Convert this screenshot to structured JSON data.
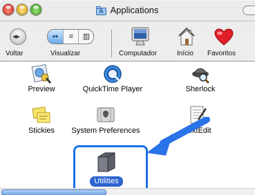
{
  "window": {
    "title": "Applications",
    "accent_color": "#1f6fe6"
  },
  "toolbar": {
    "back_label": "Voltar",
    "view_label": "Visualizar",
    "computer_label": "Computador",
    "home_label": "Início",
    "favorites_label": "Favoritos"
  },
  "items": [
    {
      "label": "Preview",
      "icon": "preview-icon"
    },
    {
      "label": "QuickTime Player",
      "icon": "quicktime-icon"
    },
    {
      "label": "Sherlock",
      "icon": "sherlock-icon"
    },
    {
      "label": "Stickies",
      "icon": "stickies-icon"
    },
    {
      "label": "System Preferences",
      "icon": "system-preferences-icon"
    },
    {
      "label": "TextEdit",
      "icon": "textedit-icon"
    },
    {
      "label": "Utilities",
      "icon": "folder-icon",
      "selected": true
    }
  ]
}
